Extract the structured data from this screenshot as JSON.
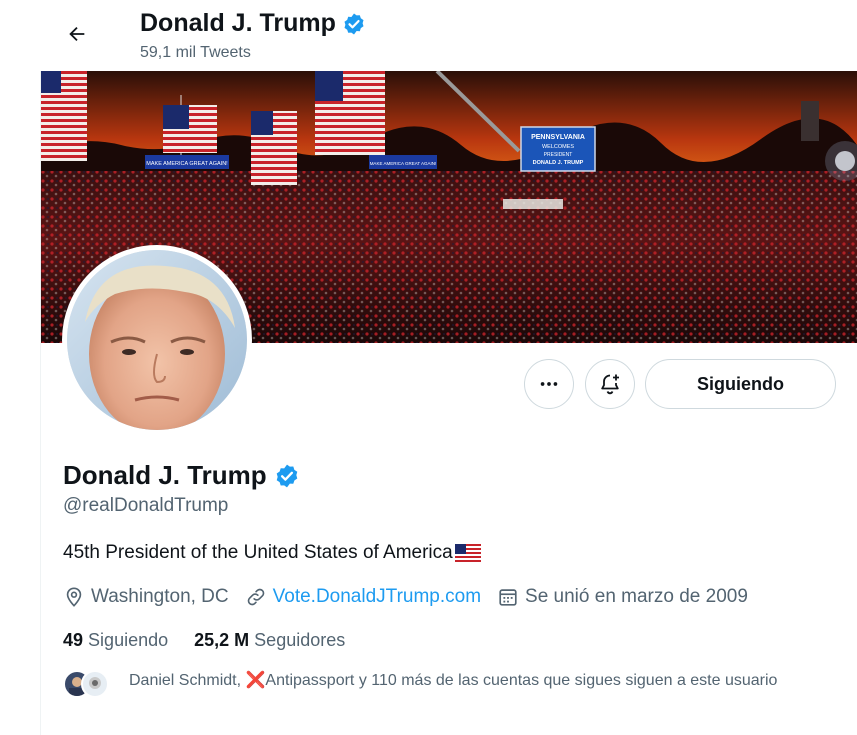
{
  "header": {
    "title": "Donald J. Trump",
    "tweet_count": "59,1 mil Tweets"
  },
  "banner": {
    "signs": [
      "MAKE AMERICA GREAT AGAIN!",
      "MAKE AMERICA GREAT AGAIN!",
      "MAKE AMERICA GREAT AGAIN!"
    ],
    "screen_lines": [
      "PENNSYLVANIA",
      "WELCOMES",
      "PRESIDENT",
      "DONALD J. TRUMP"
    ]
  },
  "actions": {
    "more_icon": "more-horizontal-icon",
    "notify_icon": "bell-plus-icon",
    "follow_label": "Siguiendo"
  },
  "profile": {
    "name": "Donald J. Trump",
    "handle": "@realDonaldTrump",
    "bio": "45th President of the United States of America",
    "location": "Washington, DC",
    "website": "Vote.DonaldJTrump.com",
    "joined": "Se unió en marzo de 2009"
  },
  "stats": {
    "following_count": "49",
    "following_label": "Siguiendo",
    "followers_count": "25,2 M",
    "followers_label": "Seguidores"
  },
  "followed_by": {
    "name1": "Daniel Schmidt,",
    "x_mark": "❌",
    "name2": "Antipassport",
    "rest": "y 110 más de las cuentas que sigues siguen a este usuario"
  },
  "colors": {
    "accent": "#1d9bf0",
    "text": "#0f1419",
    "secondary": "#536471",
    "border": "#cfd9de"
  }
}
